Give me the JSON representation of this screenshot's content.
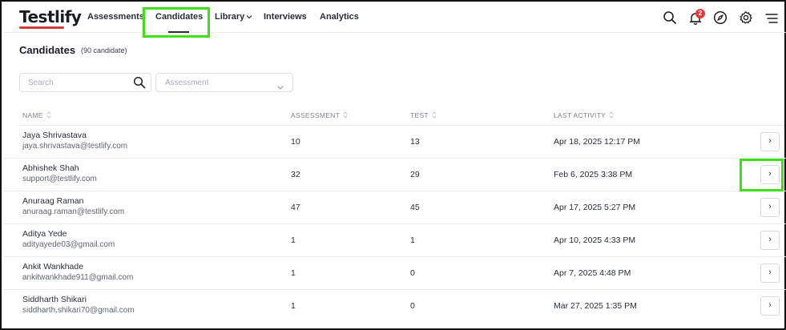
{
  "app": {
    "logo_text": "Testlify"
  },
  "nav": {
    "items": [
      {
        "label": "Assessments"
      },
      {
        "label": "Candidates"
      },
      {
        "label": "Library"
      },
      {
        "label": "Interviews"
      },
      {
        "label": "Analytics"
      }
    ],
    "active": "Candidates",
    "notification_count": "2",
    "icons": [
      "search-icon",
      "bell-icon",
      "compass-icon",
      "gear-icon",
      "menu-icon"
    ]
  },
  "page": {
    "title": "Candidates",
    "count_label": "(90 candidate)"
  },
  "filters": {
    "search_placeholder": "Search",
    "assessment_placeholder": "Assessment"
  },
  "table": {
    "columns": [
      "NAME",
      "ASSESSMENT",
      "TEST",
      "LAST ACTIVITY"
    ],
    "rows": [
      {
        "name": "Jaya Shrivastava",
        "email": "jaya.shrivastava@testlify.com",
        "assessment": "10",
        "test": "13",
        "last_activity": "Apr 18, 2025 12:17 PM"
      },
      {
        "name": "Abhishek Shah",
        "email": "support@testlify.com",
        "assessment": "32",
        "test": "29",
        "last_activity": "Feb 6, 2025 3:38 PM"
      },
      {
        "name": "Anuraag Raman",
        "email": "anuraag.raman@testlify.com",
        "assessment": "47",
        "test": "45",
        "last_activity": "Apr 17, 2025 5:27 PM"
      },
      {
        "name": "Aditya Yede",
        "email": "adityayede03@gmail.com",
        "assessment": "1",
        "test": "1",
        "last_activity": "Apr 10, 2025 4:33 PM"
      },
      {
        "name": "Ankit Wankhade",
        "email": "ankitwankhade911@gmail.com",
        "assessment": "1",
        "test": "0",
        "last_activity": "Apr 7, 2025 4:48 PM"
      },
      {
        "name": "Siddharth Shikari",
        "email": "siddharth.shikari70@gmail.com",
        "assessment": "1",
        "test": "0",
        "last_activity": "Mar 27, 2025 1:35 PM"
      }
    ],
    "row_action_glyph": "›"
  },
  "colors": {
    "highlight": "#3ee01a",
    "badge": "#e23b3b",
    "logo_accent": "#d23b3b"
  }
}
